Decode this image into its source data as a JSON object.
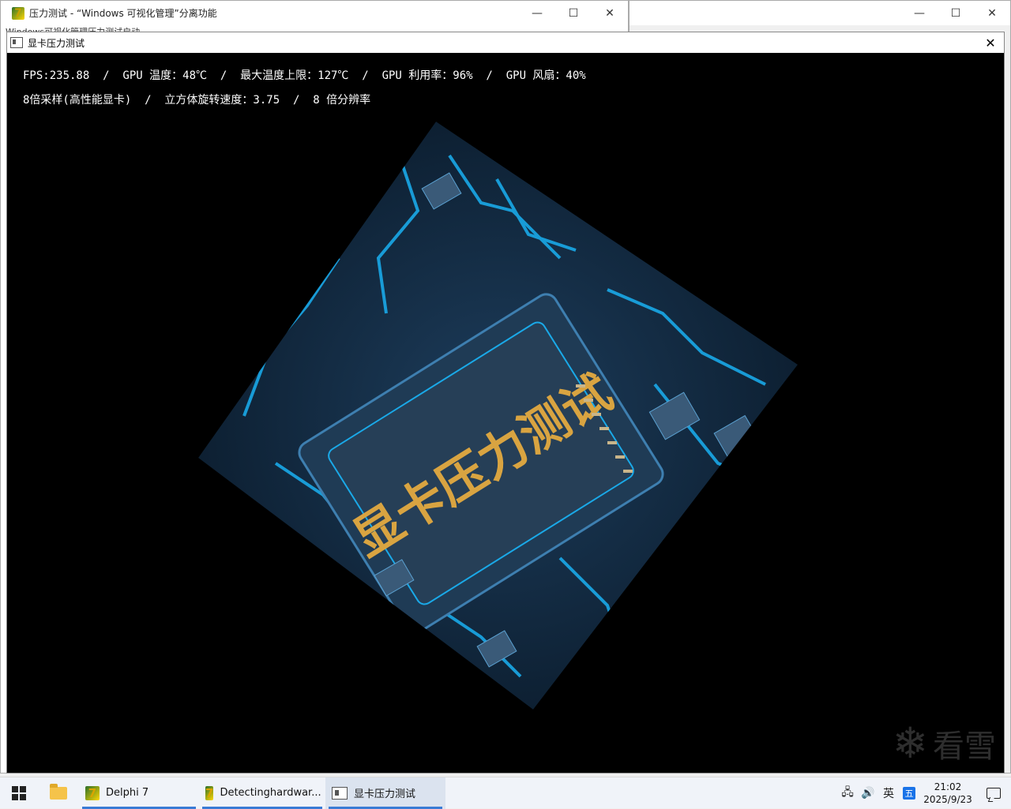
{
  "background_windows": {
    "left": {
      "title": "压力测试 - “Windows 可视化管理”分离功能",
      "subtitle": "Windows可视化管理压力测试启动"
    },
    "right": {
      "title": ""
    }
  },
  "main_window": {
    "title": "显卡压力测试",
    "hud": {
      "line1": "FPS:235.88  /  GPU 温度：48℃  /  最大温度上限：127℃  /  GPU 利用率：96%  /  GPU 风扇：40%",
      "line2": "8倍采样(高性能显卡)  /  立方体旋转速度：3.75  /  8 倍分辨率"
    },
    "cube_text": "显卡压力测试",
    "watermark": "看雪"
  },
  "taskbar": {
    "items": [
      {
        "label": "Delphi 7",
        "icon": "delphi-icon"
      },
      {
        "label": "Detectinghardwar...",
        "icon": "delphi-icon"
      },
      {
        "label": "显卡压力测试",
        "icon": "window-icon",
        "active": true
      }
    ],
    "tray": {
      "ime_lang": "英",
      "ime_mode": "五",
      "time": "21:02",
      "date": "2025/9/23"
    }
  },
  "colors": {
    "circuit_blue": "#1aa9e8",
    "chip_gold": "#d9a441",
    "taskbar_accent": "#3a7bd5"
  }
}
